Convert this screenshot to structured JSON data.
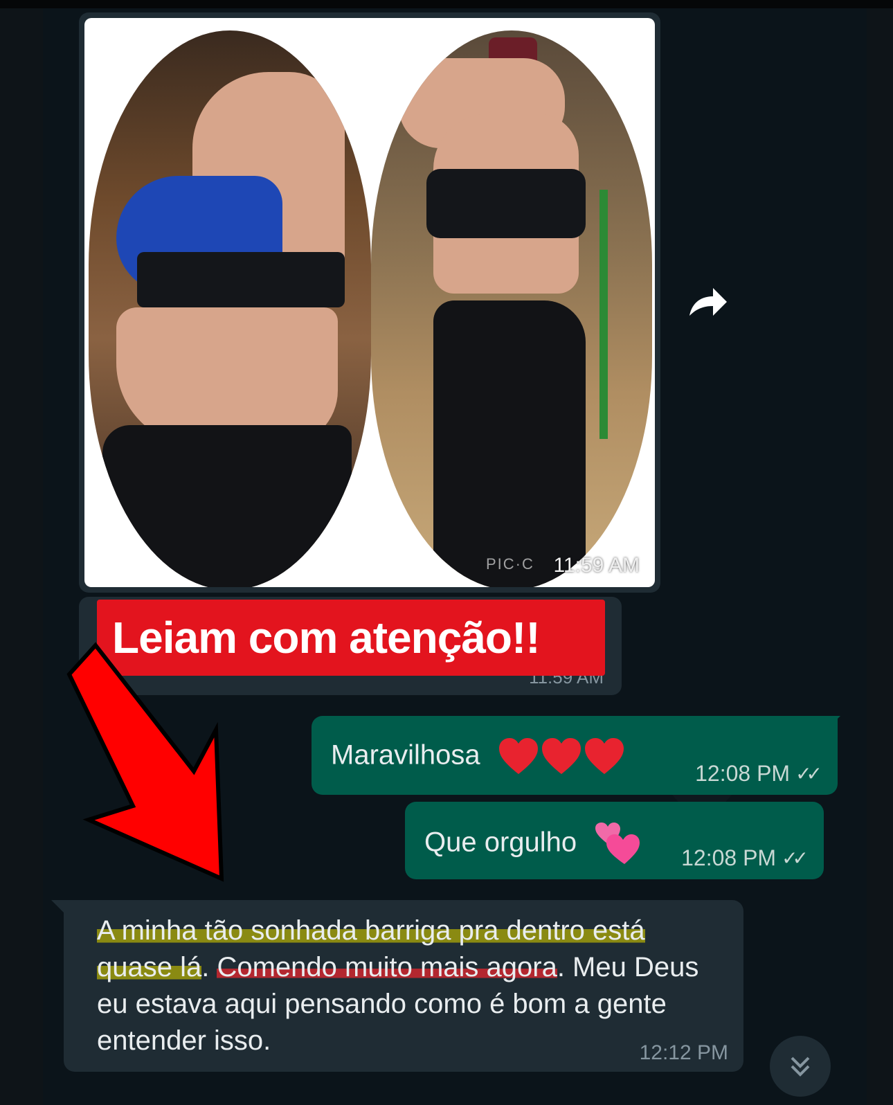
{
  "colors": {
    "chat_bg": "#0b141a",
    "incoming_bubble": "#1f2c34",
    "outgoing_bubble": "#005c4b",
    "caption_red": "#e3141e",
    "text_primary": "#e9edef",
    "text_meta": "#8696a0",
    "highlight_yellow": "#8a8a12",
    "highlight_red": "#b3272f"
  },
  "image_message": {
    "watermark": "PIC·C",
    "time": "11:59 AM"
  },
  "caption_message": {
    "overlay_text": "Leiam com atenção!!",
    "time": "11:59 AM"
  },
  "outgoing_messages": [
    {
      "text": "Maravilhosa",
      "emoji": "❤️❤️❤️",
      "time": "12:08 PM",
      "status": "read-ticks"
    },
    {
      "text": "Que orgulho",
      "emoji": "💕",
      "time": "12:08 PM",
      "status": "read-ticks"
    }
  ],
  "incoming_message": {
    "segment_1": "A minha tão sonhada barriga pra dentro está quase lá",
    "segment_2": ". ",
    "segment_3": "Comendo muito mais agora",
    "segment_4": ". Meu Deus eu estava aqui pensando como é bom a gente entender isso.",
    "time": "12:12 PM"
  },
  "icons": {
    "forward": "forward-arrow-icon",
    "scroll_down": "double-chevron-down-icon",
    "ticks": "double-check-icon"
  }
}
